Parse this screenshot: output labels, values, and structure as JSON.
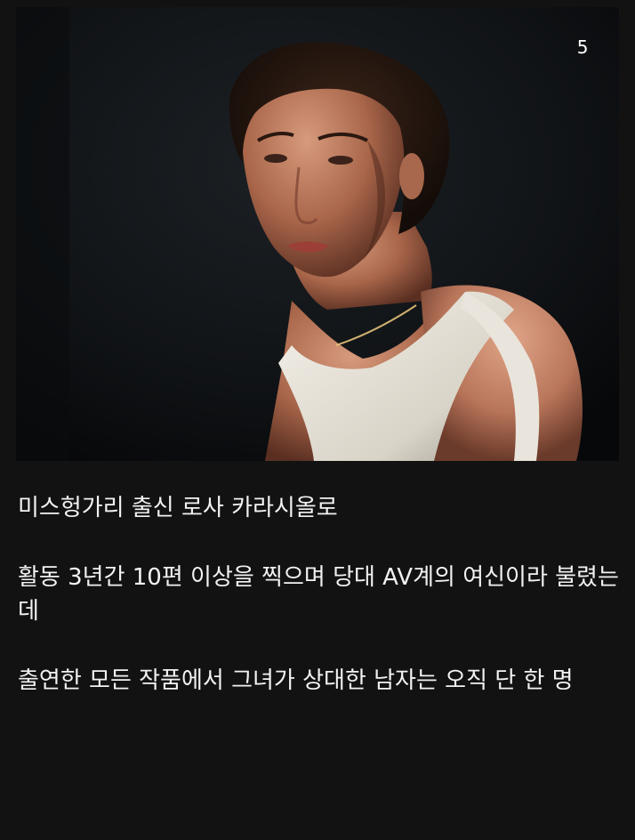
{
  "gallery": {
    "page_counter": "5",
    "photo_alt": "portrait photo"
  },
  "captions": [
    "미스헝가리 출신 로사 카라시올로",
    "활동 3년간 10편 이상을 찍으며 당대 AV계의 여신이라 불렸는데",
    "출연한 모든 작품에서 그녀가 상대한 남자는 오직 단 한 명"
  ],
  "colors": {
    "background": "#121212",
    "text": "#f2f2f2",
    "counter": "#ffffff"
  }
}
